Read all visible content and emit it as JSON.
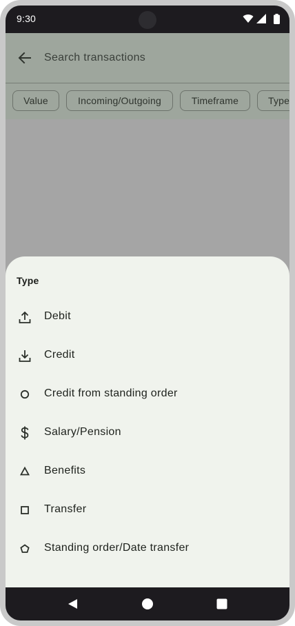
{
  "status_bar": {
    "time": "9:30"
  },
  "app_bar": {
    "search_placeholder": "Search transactions"
  },
  "filters": [
    {
      "label": "Value"
    },
    {
      "label": "Incoming/Outgoing"
    },
    {
      "label": "Timeframe"
    },
    {
      "label": "Type"
    }
  ],
  "sheet": {
    "title": "Type",
    "options": [
      {
        "label": "Debit",
        "icon": "upload-icon"
      },
      {
        "label": "Credit",
        "icon": "download-icon"
      },
      {
        "label": "Credit from standing order",
        "icon": "circle-icon"
      },
      {
        "label": "Salary/Pension",
        "icon": "dollar-icon"
      },
      {
        "label": "Benefits",
        "icon": "triangle-icon"
      },
      {
        "label": "Transfer",
        "icon": "square-icon"
      },
      {
        "label": "Standing order/Date transfer",
        "icon": "pentagon-icon"
      }
    ]
  },
  "colors": {
    "sheet_background": "#f0f3ed",
    "scrim": "#a5a5a5",
    "system_bars": "#1d1b1f"
  }
}
